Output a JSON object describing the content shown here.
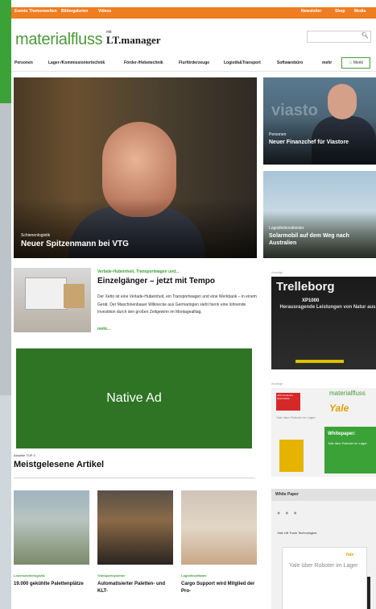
{
  "topbar": {
    "left": [
      "Events",
      "Themenwelten",
      "Bildergalerien",
      "Videos"
    ],
    "right": [
      "Newsletter",
      "Shop",
      "Media"
    ]
  },
  "logo": {
    "main": "materialfluss",
    "mit": "mit",
    "lt": "LT.manager"
  },
  "nav": {
    "items": [
      "Personen",
      "Lager-/Kommissioniertechnik",
      "Förder-/Hebetechnik",
      "Flurförderzeuge",
      "Logistik&Transport",
      "Softwarebüro"
    ],
    "more": "mehr",
    "merkliste": "Merkl"
  },
  "colors": {
    "brand_green": "#3aa237",
    "topbar_orange": "#ef7d22",
    "native_ad_green": "#2e7424"
  },
  "hero": {
    "kicker": "Schienenlogistik",
    "title": "Neuer Spitzenmann bei VTG"
  },
  "card1": {
    "watermark": "viasto",
    "kicker": "Personen",
    "title": "Neuer Finanzchef für Viastore"
  },
  "card2": {
    "kicker": "Logistikdienstleister",
    "title": "Solarmobil auf dem Weg nach Australien"
  },
  "article": {
    "kicker": "Verlade-Hubeinheit, Transportwagen und...",
    "title": "Einzelgänger – jetzt mit Tempo",
    "body": "Der Xetto ist eine Verlade-Hubeinheit, ein Transportwagen und eine Werkbank – in einem Gerät. Der Maschinenbauer Wilknecke aus Germaringen sieht hierin eine lohnende Investition durch den großen Zeitgewinn im Montagealltag.",
    "more": "mehr..."
  },
  "ads": {
    "label": "Anzeige",
    "trelleborg": {
      "brand": "Trelleborg",
      "model": "XP1000",
      "tagline": "Herausragende Leistungen von Natur aus"
    },
    "native": "Native Ad",
    "yale": {
      "mf": "materialfluss",
      "red": "Jetzt kostenlos downloaden",
      "brand": "Yale",
      "grey": "Yale über Roboter im Lager",
      "wp_title": "Whitepaper:",
      "wp_sub": "Yale über Roboter im Lager"
    }
  },
  "top3": {
    "kicker": "Aktuelle TOP 3",
    "title": "Meistgelesene Artikel",
    "items": [
      {
        "kicker": "Lebensmittellogistik",
        "title": "19.000 gekühlte Palettenplätze"
      },
      {
        "kicker": "Transportsysteme",
        "title": "Automatisierter Paletten- und KLT-"
      },
      {
        "kicker": "Logistiksoftware",
        "title": "Cargo Support wird Mitglied der Pro-"
      }
    ]
  },
  "whitepaper": {
    "head": "White Paper",
    "sub": "Yale Lift Truck Technologies",
    "doc_title": "Yale über Roboter im Lager",
    "doc_brand": "Yale"
  }
}
